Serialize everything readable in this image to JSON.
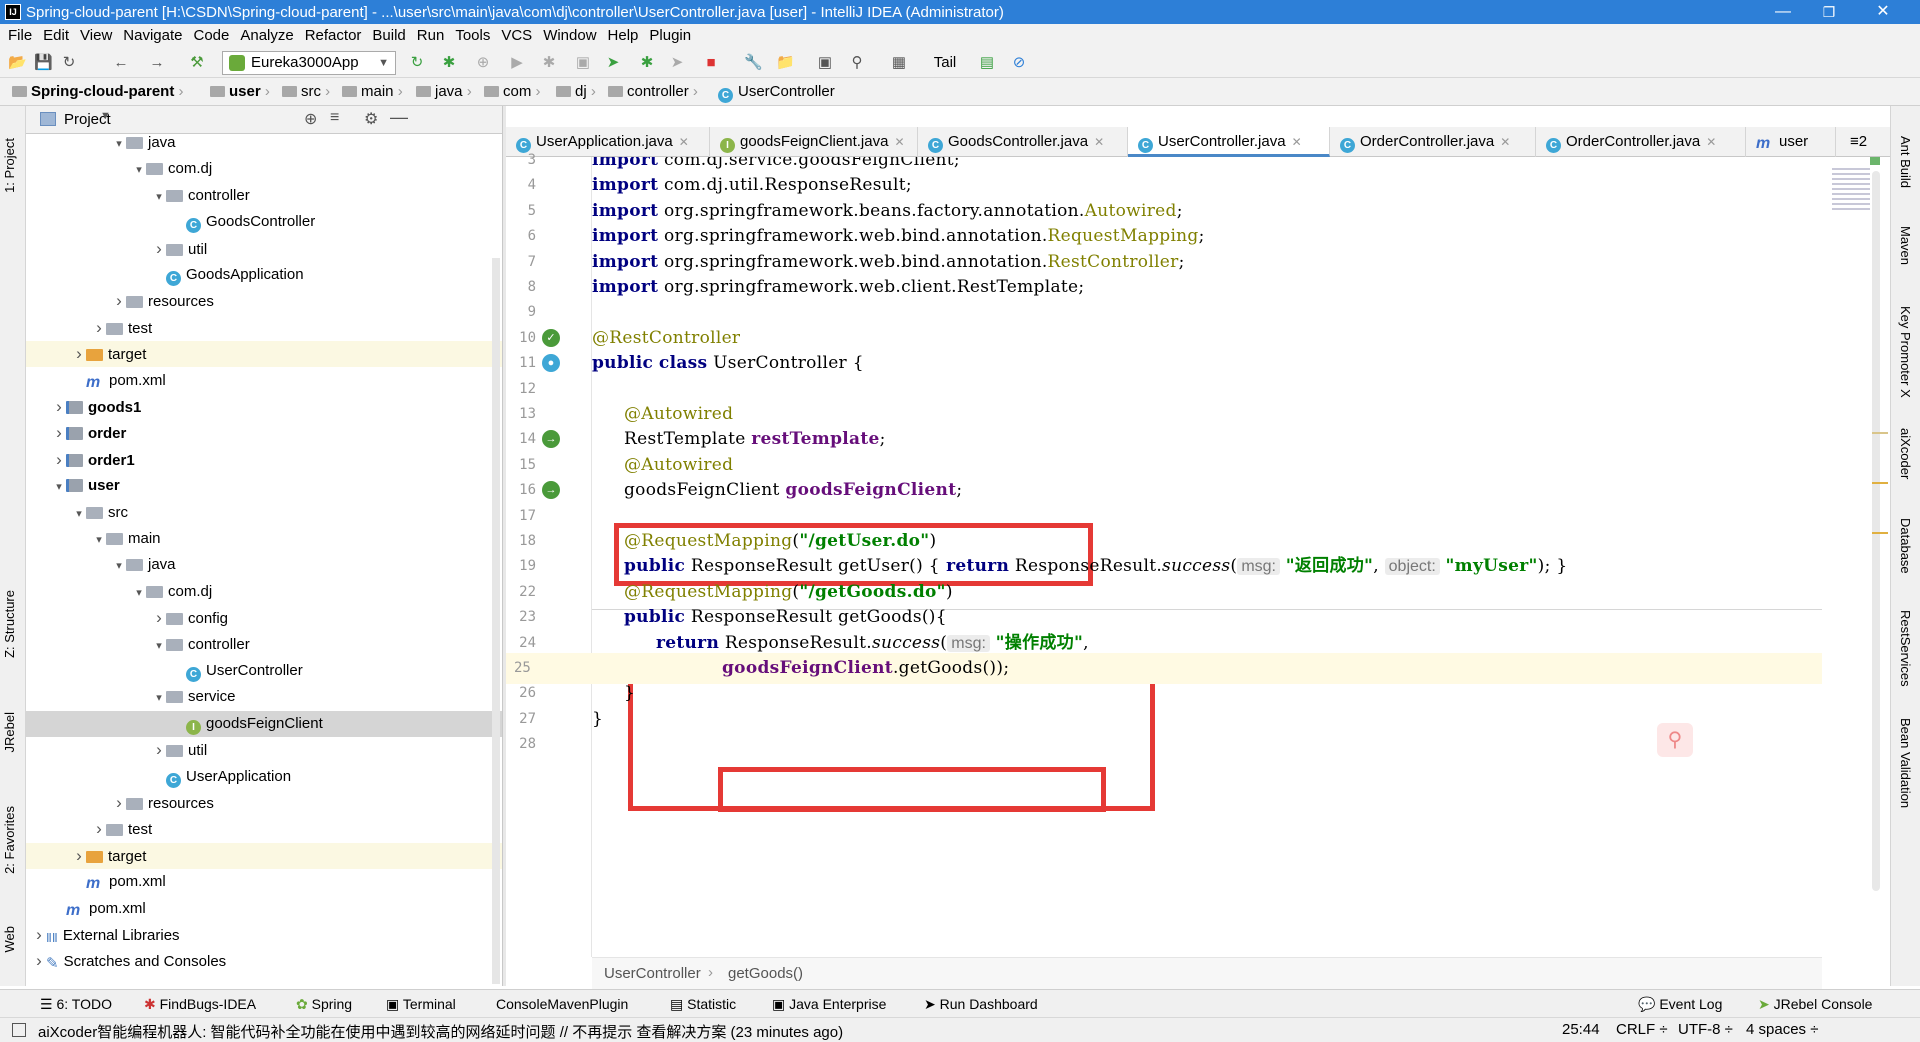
{
  "window": {
    "title": "Spring-cloud-parent [H:\\CSDN\\Spring-cloud-parent] - ...\\user\\src\\main\\java\\com\\dj\\controller\\UserController.java [user] - IntelliJ IDEA (Administrator)",
    "app_icon": "IJ",
    "minimize": "—",
    "maximize": "❐",
    "close": "✕"
  },
  "menu": [
    "File",
    "Edit",
    "View",
    "Navigate",
    "Code",
    "Analyze",
    "Refactor",
    "Build",
    "Run",
    "Tools",
    "VCS",
    "Window",
    "Help",
    "Plugin"
  ],
  "toolbar": {
    "run_config": "Eureka3000App",
    "tail_label": "Tail"
  },
  "breadcrumb": [
    "Spring-cloud-parent",
    "user",
    "src",
    "main",
    "java",
    "com",
    "dj",
    "controller",
    "UserController"
  ],
  "left_strip": {
    "project": "1: Project",
    "structure": "Z: Structure",
    "jrebel": "JRebel",
    "favorites": "2: Favorites",
    "web": "Web"
  },
  "project_panel": {
    "title": "Project",
    "tree": [
      {
        "label": "java",
        "indent": 5,
        "arrow": "v",
        "icon": "folder"
      },
      {
        "label": "com.dj",
        "indent": 6,
        "arrow": "v",
        "icon": "folder"
      },
      {
        "label": "controller",
        "indent": 7,
        "arrow": "v",
        "icon": "folder"
      },
      {
        "label": "GoodsController",
        "indent": 8,
        "arrow": "",
        "icon": "class"
      },
      {
        "label": "util",
        "indent": 7,
        "arrow": ">",
        "icon": "folder"
      },
      {
        "label": "GoodsApplication",
        "indent": 7,
        "arrow": "",
        "icon": "class"
      },
      {
        "label": "resources",
        "indent": 5,
        "arrow": ">",
        "icon": "folder"
      },
      {
        "label": "test",
        "indent": 4,
        "arrow": ">",
        "icon": "folder"
      },
      {
        "label": "target",
        "indent": 3,
        "arrow": ">",
        "icon": "ofolder",
        "state": "target"
      },
      {
        "label": "pom.xml",
        "indent": 3,
        "arrow": "",
        "icon": "maven"
      },
      {
        "label": "goods1",
        "indent": 2,
        "arrow": ">",
        "icon": "module",
        "bold": true
      },
      {
        "label": "order",
        "indent": 2,
        "arrow": ">",
        "icon": "module",
        "bold": true
      },
      {
        "label": "order1",
        "indent": 2,
        "arrow": ">",
        "icon": "module",
        "bold": true
      },
      {
        "label": "user",
        "indent": 2,
        "arrow": "v",
        "icon": "module",
        "bold": true
      },
      {
        "label": "src",
        "indent": 3,
        "arrow": "v",
        "icon": "folder"
      },
      {
        "label": "main",
        "indent": 4,
        "arrow": "v",
        "icon": "folder"
      },
      {
        "label": "java",
        "indent": 5,
        "arrow": "v",
        "icon": "folder"
      },
      {
        "label": "com.dj",
        "indent": 6,
        "arrow": "v",
        "icon": "folder"
      },
      {
        "label": "config",
        "indent": 7,
        "arrow": ">",
        "icon": "folder"
      },
      {
        "label": "controller",
        "indent": 7,
        "arrow": "v",
        "icon": "folder"
      },
      {
        "label": "UserController",
        "indent": 8,
        "arrow": "",
        "icon": "class"
      },
      {
        "label": "service",
        "indent": 7,
        "arrow": "v",
        "icon": "folder"
      },
      {
        "label": "goodsFeignClient",
        "indent": 8,
        "arrow": "",
        "icon": "interface",
        "state": "selected"
      },
      {
        "label": "util",
        "indent": 7,
        "arrow": ">",
        "icon": "folder"
      },
      {
        "label": "UserApplication",
        "indent": 7,
        "arrow": "",
        "icon": "class"
      },
      {
        "label": "resources",
        "indent": 5,
        "arrow": ">",
        "icon": "folder"
      },
      {
        "label": "test",
        "indent": 4,
        "arrow": ">",
        "icon": "folder"
      },
      {
        "label": "target",
        "indent": 3,
        "arrow": ">",
        "icon": "ofolder",
        "state": "target"
      },
      {
        "label": "pom.xml",
        "indent": 3,
        "arrow": "",
        "icon": "maven"
      },
      {
        "label": "pom.xml",
        "indent": 2,
        "arrow": "",
        "icon": "maven"
      },
      {
        "label": "External Libraries",
        "indent": 1,
        "arrow": ">",
        "icon": "libs"
      },
      {
        "label": "Scratches and Consoles",
        "indent": 1,
        "arrow": ">",
        "icon": "scratch"
      }
    ]
  },
  "tabs": [
    {
      "label": "UserApplication.java",
      "icon": "C"
    },
    {
      "label": "goodsFeignClient.java",
      "icon": "I"
    },
    {
      "label": "GoodsController.java",
      "icon": "C"
    },
    {
      "label": "UserController.java",
      "icon": "C",
      "active": true
    },
    {
      "label": "OrderController.java",
      "icon": "C"
    },
    {
      "label": "OrderController.java",
      "icon": "C"
    },
    {
      "label": "user",
      "icon": "m"
    }
  ],
  "tab_overflow": "≡2",
  "editor": {
    "line_numbers": [
      "3",
      "4",
      "5",
      "6",
      "7",
      "8",
      "9",
      "10",
      "11",
      "12",
      "13",
      "14",
      "15",
      "16",
      "17",
      "18",
      "19",
      "22",
      "23",
      "24",
      "25",
      "26",
      "27",
      "28"
    ],
    "lines": {
      "l3": {
        "kw": "import",
        "rest": " com.dj.service.goodsFeignClient;"
      },
      "l4": {
        "kw": "import",
        "rest": " com.dj.util.ResponseResult;"
      },
      "l5": {
        "kw": "import",
        "rest": " org.springframework.beans.factory.annotation.",
        "ann": "Autowired",
        "end": ";"
      },
      "l6": {
        "kw": "import",
        "rest": " org.springframework.web.bind.annotation.",
        "ann": "RequestMapping",
        "end": ";"
      },
      "l7": {
        "kw": "import",
        "rest": " org.springframework.web.bind.annotation.",
        "ann": "RestController",
        "end": ";"
      },
      "l8": {
        "kw": "import",
        "rest": " org.springframework.web.client.RestTemplate;"
      },
      "l10": {
        "ann": "@RestController"
      },
      "l11": {
        "kw1": "public",
        "kw2": "class",
        "rest": " UserController ",
        "brace": "{"
      },
      "l13": {
        "ann": "@Autowired"
      },
      "l14": {
        "type": "RestTemplate ",
        "field": "restTemplate",
        "end": ";"
      },
      "l15": {
        "ann": "@Autowired"
      },
      "l16": {
        "type": "goodsFeignClient ",
        "field": "goodsFeignClient",
        "end": ";"
      },
      "l18": {
        "ann": "@RequestMapping",
        "open": "(",
        "str": "\"/getUser.do\"",
        "close": ")"
      },
      "l19": {
        "kw": "public",
        "rest": " ResponseResult getUser() ",
        "b1": "{",
        "kw2": " return",
        "rest2": " ResponseResult.",
        "call": "success",
        "p": "(",
        "h1": "msg:",
        "s1": "\"返回成功\"",
        "comma": ",",
        "h2": "object:",
        "s2": "\"myUser\"",
        "tail": "); ",
        "b2": "}"
      },
      "l22": {
        "ann": "@RequestMapping",
        "open": "(",
        "str": "\"/getGoods.do\"",
        "close": ")"
      },
      "l23": {
        "kw": "public",
        "rest": " ResponseResult getGoods(){"
      },
      "l24": {
        "kw": "return",
        "rest": " ResponseResult.",
        "call": "success",
        "p": "(",
        "h1": "msg:",
        "s1": "\"操作成功\"",
        "comma": ","
      },
      "l25": {
        "field": "goodsFeignClient",
        "rest": ".getGoods()",
        "close": ")",
        "end": ";"
      },
      "l26": {
        "brace": "}"
      },
      "l27": {
        "brace": "}"
      }
    },
    "breadcrumb": [
      "UserController",
      "getGoods()"
    ]
  },
  "right_strip": [
    "Ant Build",
    "Maven",
    "Key Promoter X",
    "aiXcoder",
    "Database",
    "RestServices",
    "Bean Validation"
  ],
  "bottom_tools": [
    "6: TODO",
    "FindBugs-IDEA",
    "Spring",
    "Terminal",
    "ConsoleMavenPlugin",
    "Statistic",
    "Java Enterprise",
    "Run Dashboard",
    "Event Log",
    "JRebel Console"
  ],
  "status": {
    "message": "aiXcoder智能编程机器人: 智能代码补全功能在使用中遇到较高的网络延时问题 // 不再提示 查看解决方案 (23 minutes ago)",
    "position": "25:44",
    "line_sep": "CRLF ÷",
    "encoding": "UTF-8 ÷",
    "indent": "4 spaces ÷"
  },
  "colors": {
    "titlebar": "#2d7fd7",
    "keyword": "#000080",
    "annotation": "#808000",
    "string": "#008000",
    "field": "#660e7a",
    "highlight_box": "#e53935"
  }
}
